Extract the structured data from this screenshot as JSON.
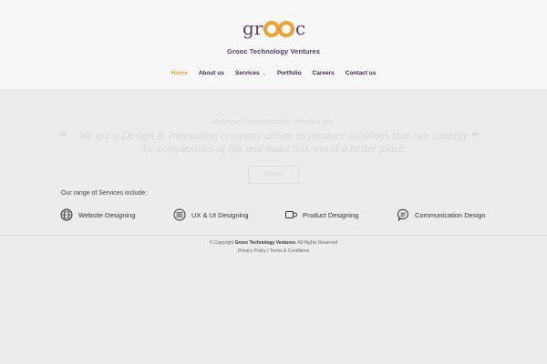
{
  "brand": {
    "logo_text": "grooc",
    "tagline": "Grooc Technology Ventures",
    "colors": {
      "purple": "#5a3a6a",
      "orange": "#f0a030"
    }
  },
  "nav": {
    "items": [
      {
        "label": "Home",
        "active": true
      },
      {
        "label": "About us"
      },
      {
        "label": "Services",
        "has_dropdown": true
      },
      {
        "label": "Portfolio"
      },
      {
        "label": "Careers"
      },
      {
        "label": "Contact us"
      }
    ]
  },
  "hero": {
    "subtitle": "Welcome! Let us introduce ourselves first",
    "quote": "We are a Design & Innovation company driven to produce solutions that can simplify the complexities of life and make this world a better place.",
    "button_label": "Explore"
  },
  "services": {
    "title": "Our range of Services include:",
    "items": [
      {
        "label": "Website Designing",
        "icon": "globe-icon"
      },
      {
        "label": "UX & UI Designing",
        "icon": "list-icon"
      },
      {
        "label": "Product Designing",
        "icon": "mug-icon"
      },
      {
        "label": "Communication Design",
        "icon": "speech-bubble-icon"
      }
    ]
  },
  "footer": {
    "copyright_prefix": "© Copyright ",
    "company": "Grooc Technology Ventures",
    "rights": ". All Rights Reserved",
    "privacy": "Privacy Policy",
    "separator": " | ",
    "terms": "Terms & Conditions"
  }
}
